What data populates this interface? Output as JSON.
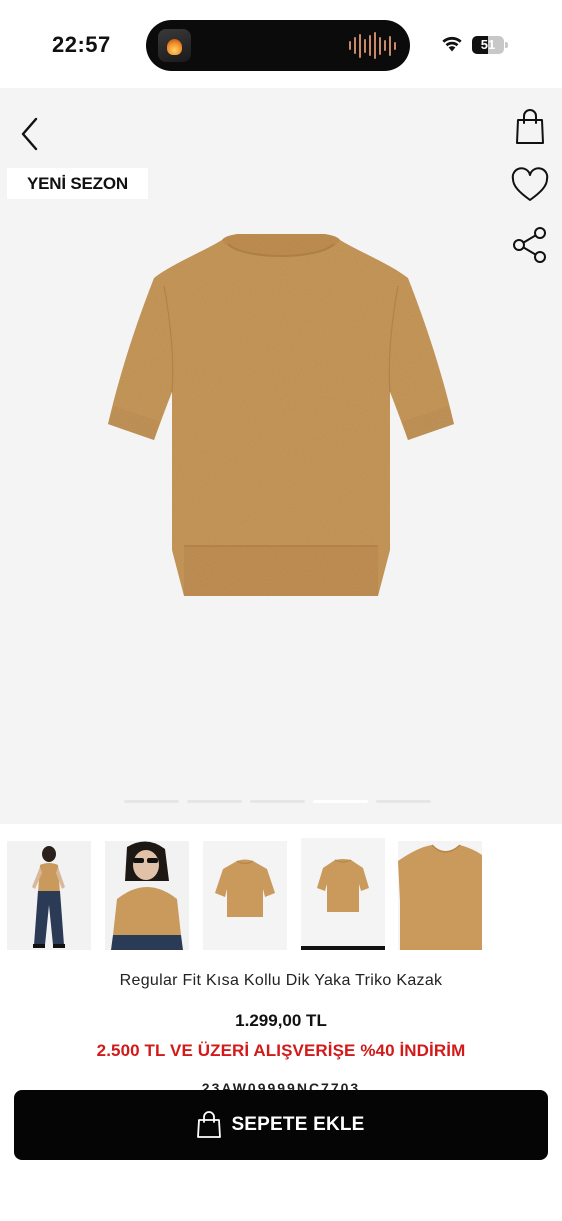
{
  "status_bar": {
    "time": "22:57",
    "battery_percent": "51",
    "battery_level": 0.51
  },
  "product": {
    "badge": "YENİ SEZON",
    "title": "Regular Fit Kısa Kollu Dik Yaka Triko Kazak",
    "price": "1.299,00 TL",
    "promo": "2.500 TL VE ÜZERİ ALIŞVERİŞE %40 İNDİRİM",
    "sku": "23AW09999NC7703",
    "color": "#c99a5b"
  },
  "gallery": {
    "image_count": 5,
    "active_index": 4,
    "selected_thumbnail": 4
  },
  "icons": {
    "back": "chevron-left-icon",
    "bag": "shopping-bag-icon",
    "favorite": "heart-icon",
    "share": "share-icon"
  },
  "cta": {
    "label": "SEPETE EKLE"
  }
}
